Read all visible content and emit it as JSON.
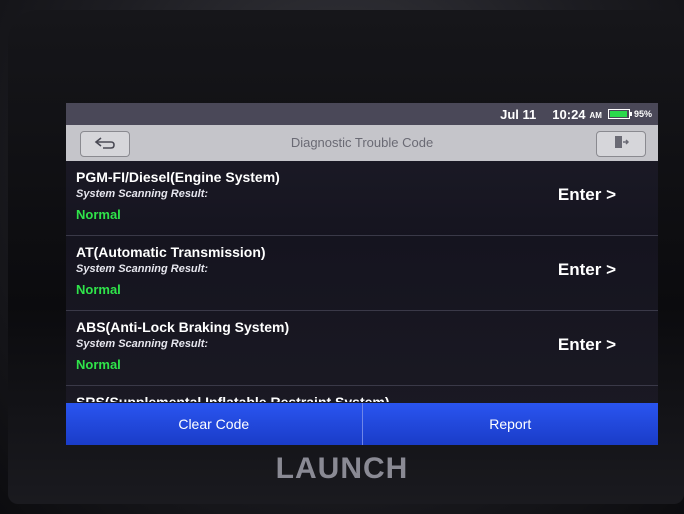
{
  "status": {
    "date": "Jul 11",
    "time": "10:24",
    "ampm": "AM",
    "battery": "95%",
    "battery_level": 0.95,
    "battery_color": "#2bd94c"
  },
  "header": {
    "title": "Diagnostic Trouble Code",
    "back_icon": "back-arrow-icon",
    "exit_icon": "exit-icon"
  },
  "systems": [
    {
      "name": "PGM-FI/Diesel(Engine System)",
      "subtitle": "System Scanning Result:",
      "status": "Normal",
      "action": "Enter >"
    },
    {
      "name": "AT(Automatic Transmission)",
      "subtitle": "System Scanning Result:",
      "status": "Normal",
      "action": "Enter >"
    },
    {
      "name": "ABS(Anti-Lock Braking System)",
      "subtitle": "System Scanning Result:",
      "status": "Normal",
      "action": "Enter >"
    },
    {
      "name": "SRS(Supplemental Inflatable Restraint System)"
    }
  ],
  "footer": {
    "clear_code": "Clear Code",
    "report": "Report",
    "accent": "#1f45d8"
  },
  "brand": "LAUNCH"
}
